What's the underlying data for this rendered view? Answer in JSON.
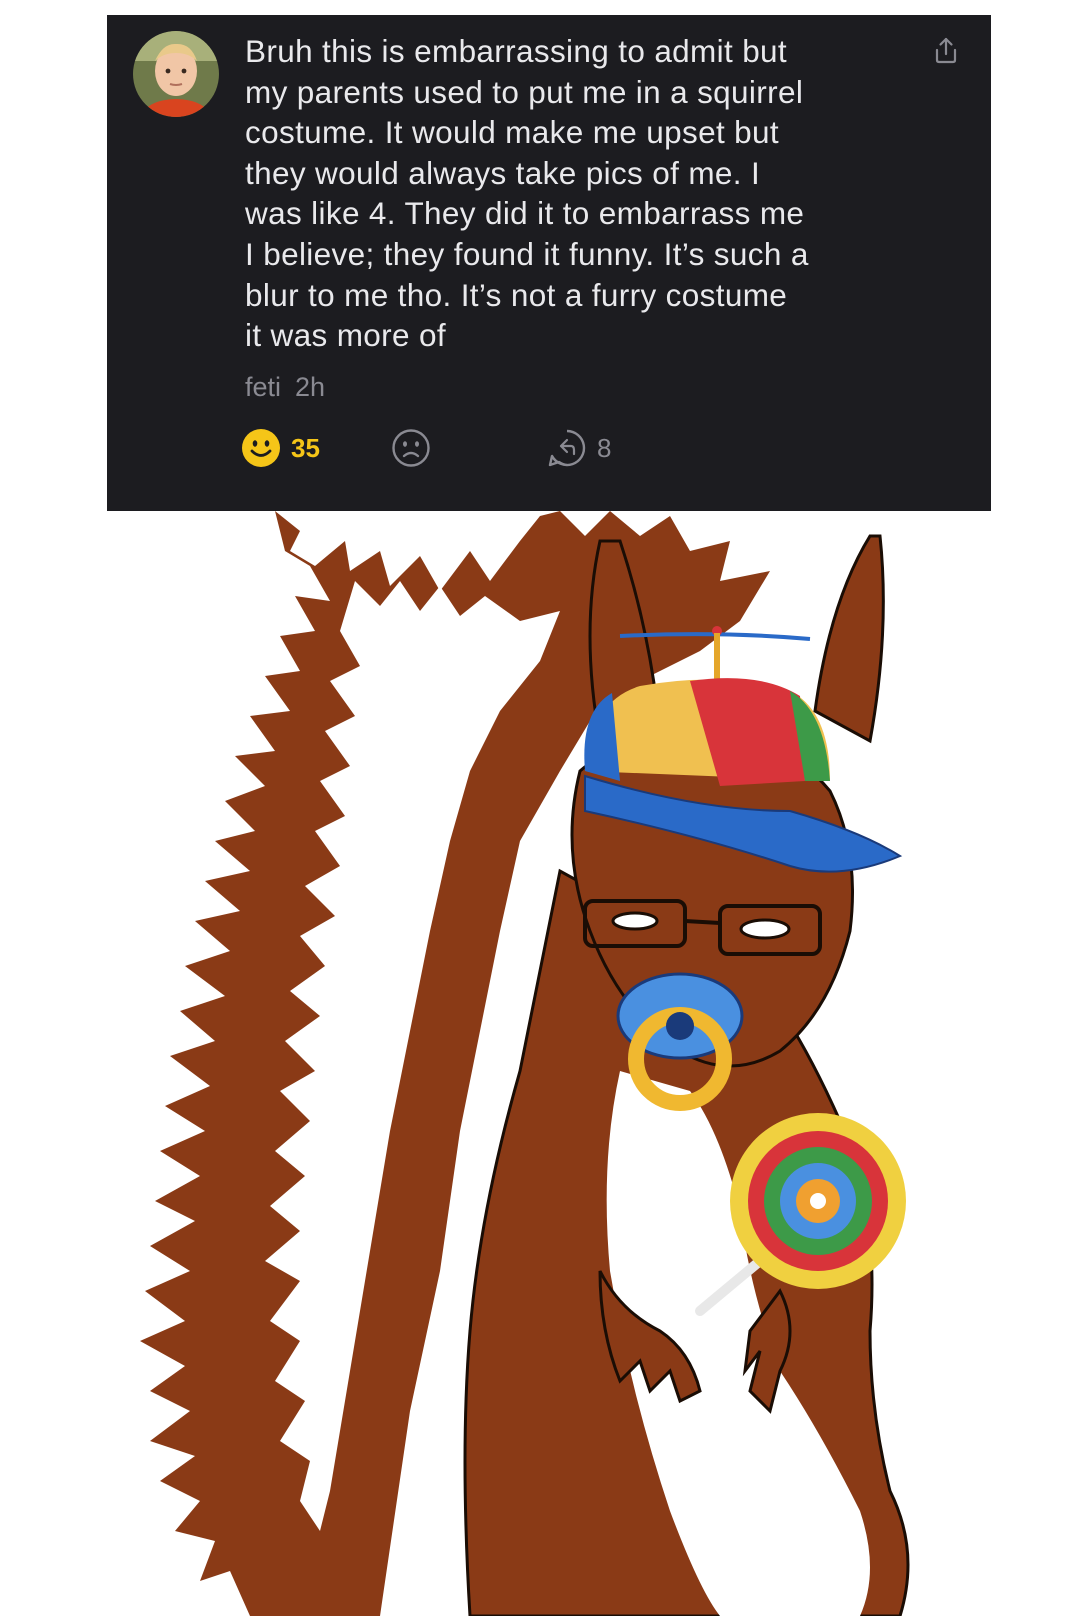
{
  "comment": {
    "text": "Bruh this is embarrassing to admit but\nmy parents used to put me in a squirrel\ncostume. It would make me upset but\nthey would always take pics of me. I\nwas like 4. They did it to embarrass me\nI believe; they found it funny. It’s such a\nblur to me tho. It’s not a furry costume\nit was more of",
    "author": "feti",
    "time": "2h",
    "likes": "35",
    "replies": "8"
  },
  "icons": {
    "share": "share-icon",
    "like": "smile-icon",
    "dislike": "frown-icon",
    "reply": "reply-icon"
  },
  "colors": {
    "card_background": "#1c1c20",
    "text": "#e9e9ec",
    "meta": "#8a8a92",
    "like_accent": "#f5c518",
    "squirrel_fur": "#8a3a16"
  }
}
